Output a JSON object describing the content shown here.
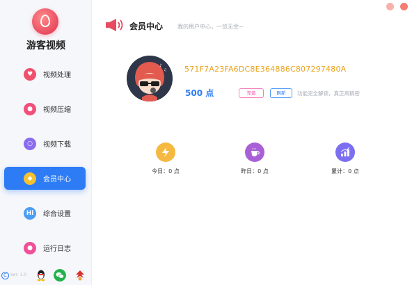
{
  "app": {
    "name": "游客视频"
  },
  "sidebar": {
    "items": [
      {
        "label": "视频处理",
        "color": "#f0506e"
      },
      {
        "label": "视频压缩",
        "color": "#f0507a"
      },
      {
        "label": "视频下载",
        "color": "#8b6cf0"
      },
      {
        "label": "会员中心",
        "color": "#f5c12e",
        "active": true
      },
      {
        "label": "综合设置",
        "color": "#4b9df5",
        "icon_text": "Hi"
      },
      {
        "label": "运行日志",
        "color": "#f0509a"
      }
    ],
    "footer": {
      "copyright_symbol": "C",
      "version": "Ver: 1.0"
    }
  },
  "header": {
    "title": "会员中心",
    "subtitle": "我的用户中心，一览无余~"
  },
  "profile": {
    "member_id": "571F7A23FA6DC8E364886C807297480A",
    "points": "500 点",
    "recharge_label": "充值",
    "refresh_label": "刷新",
    "hint": "功能完全解锁，真正高精密"
  },
  "stats": [
    {
      "label": "今日：0 点",
      "color": "#f5b942"
    },
    {
      "label": "昨日：0 点",
      "color": "#a95fd6"
    },
    {
      "label": "累计：0 点",
      "color": "#7b6ef0"
    }
  ],
  "colors": {
    "accent": "#2d7cf6",
    "brand": "#e84a5f",
    "gold": "#e9a21a"
  }
}
